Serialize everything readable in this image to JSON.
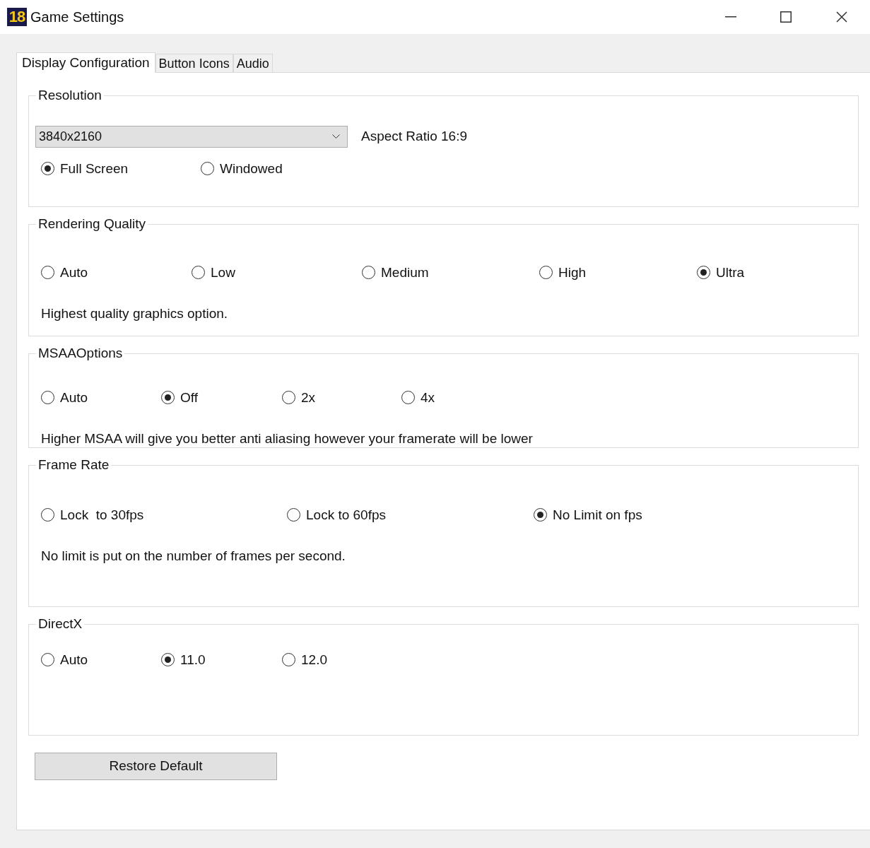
{
  "window": {
    "logo_text": "18",
    "title": "Game Settings"
  },
  "tabs": [
    {
      "label": "Display Configuration",
      "selected": true
    },
    {
      "label": "Button Icons",
      "selected": false
    },
    {
      "label": "Audio",
      "selected": false
    }
  ],
  "groups": [
    {
      "title": "Resolution",
      "dropdown": {
        "value": "3840x2160"
      },
      "aspect_label": "Aspect Ratio 16:9",
      "options": [
        {
          "label": "Full Screen",
          "selected": true
        },
        {
          "label": "Windowed",
          "selected": false
        }
      ]
    },
    {
      "title": "Rendering Quality",
      "options": [
        {
          "label": "Auto",
          "selected": false
        },
        {
          "label": "Low",
          "selected": false
        },
        {
          "label": "Medium",
          "selected": false
        },
        {
          "label": "High",
          "selected": false
        },
        {
          "label": "Ultra",
          "selected": true
        }
      ],
      "description": "Highest quality graphics option."
    },
    {
      "title": "MSAAOptions",
      "options": [
        {
          "label": "Auto",
          "selected": false
        },
        {
          "label": "Off",
          "selected": true
        },
        {
          "label": "2x",
          "selected": false
        },
        {
          "label": "4x",
          "selected": false
        }
      ],
      "description": "Higher MSAA will give you better anti aliasing however your framerate will be lower"
    },
    {
      "title": "Frame Rate",
      "options": [
        {
          "label": "Lock  to 30fps",
          "selected": false
        },
        {
          "label": "Lock to 60fps",
          "selected": false
        },
        {
          "label": "No Limit on fps",
          "selected": true
        }
      ],
      "description": "No limit is put on the number of frames per second."
    },
    {
      "title": "DirectX",
      "options": [
        {
          "label": "Auto",
          "selected": false
        },
        {
          "label": "11.0",
          "selected": true
        },
        {
          "label": "12.0",
          "selected": false
        }
      ]
    }
  ],
  "restore_button": "Restore Default"
}
